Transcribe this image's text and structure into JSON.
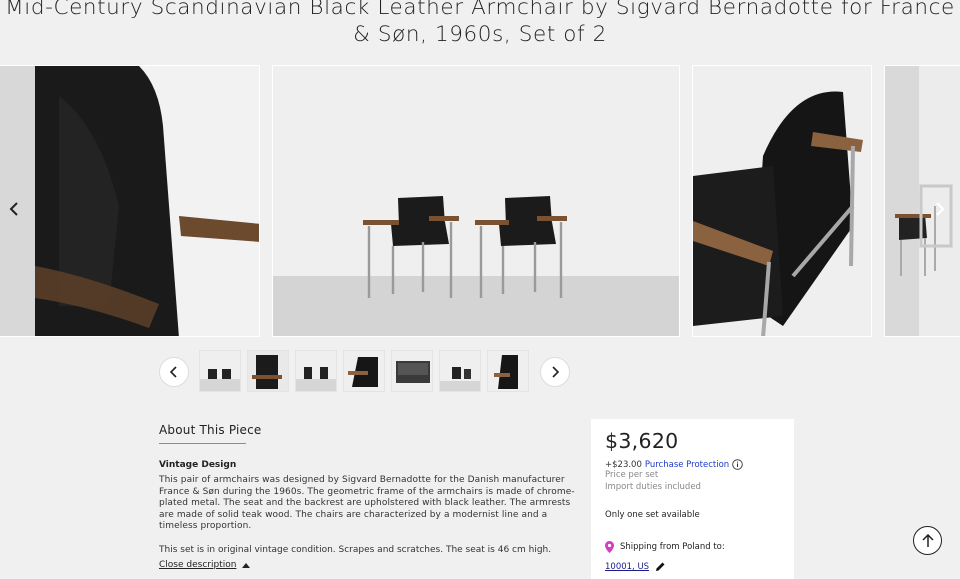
{
  "title": "Mid-Century Scandinavian Black Leather Armchair by Sigvard Bernadotte for France & Søn, 1960s, Set of 2",
  "gallery": {
    "prev_icon": "chevron-left-icon",
    "next_icon": "chevron-right-icon"
  },
  "about": {
    "title": "About This Piece",
    "section_title": "Vintage Design",
    "description": "This pair of armchairs was designed by Sigvard Bernadotte for the Danish manufacturer France & Søn during the 1960s. The geometric frame of the armchairs is made of chrome-plated metal. The seat and the backrest are upholstered with black leather. The armrests are made of solid teak wood. The chairs are characterized by a modernist line and a timeless proportion.",
    "condition": "This set is in original vintage condition. Scrapes and scratches. The seat is 46 cm high.",
    "close_label": "Close description"
  },
  "price_card": {
    "price": "$3,620",
    "protection_prefix": "+$23.00",
    "protection_link": "Purchase Protection",
    "price_per": "Price per set",
    "duties": "Import duties included",
    "availability": "Only one set available",
    "shipping": "Shipping from Poland to:",
    "zip": "10001, US"
  },
  "colors": {
    "accent_rule": "#4ca8a4",
    "link": "#1c3bcd",
    "pin": "#d43fc0"
  }
}
